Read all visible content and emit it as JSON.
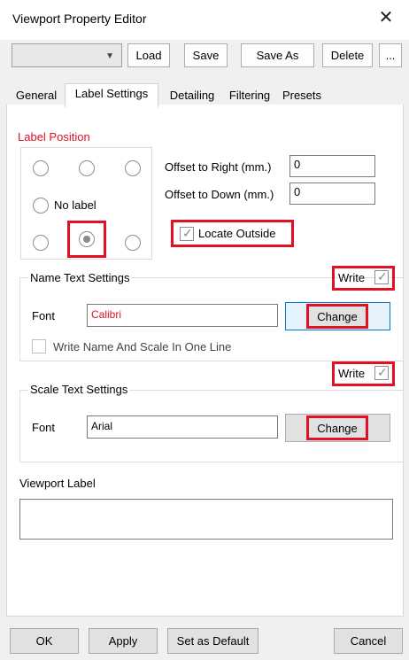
{
  "window": {
    "title": "Viewport Property Editor",
    "close_glyph": "✕"
  },
  "toolbar": {
    "preset_value": "",
    "load": "Load",
    "save": "Save",
    "save_as": "Save As",
    "delete": "Delete",
    "more": "..."
  },
  "tabs": [
    "General",
    "Label Settings",
    "Detailing",
    "Filtering",
    "Presets"
  ],
  "label_position": {
    "title": "Label Position",
    "no_label": "No label",
    "offset_right_label": "Offset to Right (mm.)",
    "offset_right_value": "0",
    "offset_down_label": "Offset to Down (mm.)",
    "offset_down_value": "0",
    "locate_outside": "Locate Outside"
  },
  "name_text": {
    "title": "Name Text Settings",
    "write": "Write",
    "font_label": "Font",
    "font_value": "Calibri",
    "change": "Change",
    "one_line": "Write Name And Scale In One Line"
  },
  "scale_text": {
    "title": "Scale Text Settings",
    "write": "Write",
    "font_label": "Font",
    "font_value": "Arial",
    "change": "Change"
  },
  "viewport_label": {
    "title": "Viewport Label",
    "value": ""
  },
  "footer": {
    "ok": "OK",
    "apply": "Apply",
    "set_default": "Set as Default",
    "cancel": "Cancel"
  },
  "colors": {
    "highlight": "#e01025",
    "calibri_text": "#e01025"
  }
}
